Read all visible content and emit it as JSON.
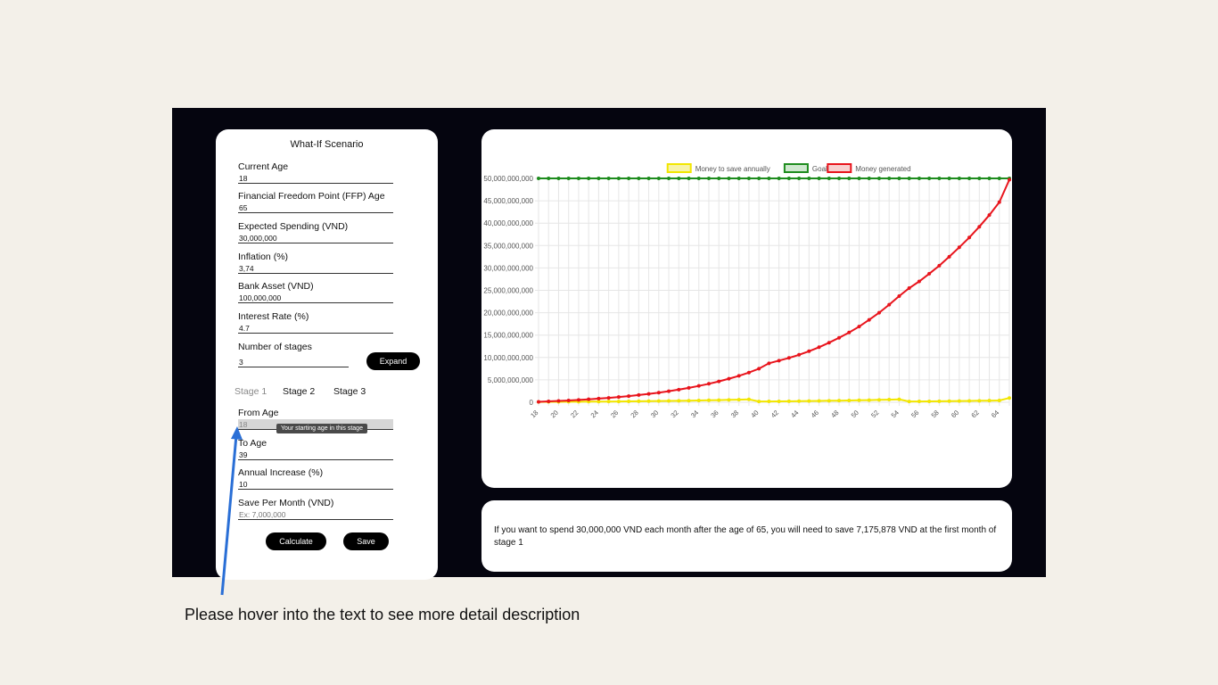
{
  "form": {
    "title": "What-If Scenario",
    "current_age": {
      "label": "Current Age",
      "value": "18"
    },
    "ffp_age": {
      "label": "Financial Freedom Point (FFP) Age",
      "value": "65"
    },
    "spending": {
      "label": "Expected Spending (VND)",
      "value": "30,000,000"
    },
    "inflation": {
      "label": "Inflation (%)",
      "value": "3,74"
    },
    "bank_asset": {
      "label": "Bank Asset (VND)",
      "value": "100,000,000"
    },
    "interest_rate": {
      "label": "Interest Rate (%)",
      "value": "4.7"
    },
    "stages": {
      "label": "Number of stages",
      "value": "3"
    },
    "expand_button": "Expand",
    "tabs": [
      "Stage 1",
      "Stage 2",
      "Stage 3"
    ],
    "from_age": {
      "label": "From Age",
      "value": "18",
      "tooltip": "Your starting age in this stage"
    },
    "to_age": {
      "label": "To Age",
      "value": "39"
    },
    "annual_increase": {
      "label": "Annual Increase (%)",
      "value": "10"
    },
    "save_per_month": {
      "label": "Save Per Month (VND)",
      "placeholder": "Ex: 7,000,000"
    },
    "calculate_button": "Calculate",
    "save_button": "Save"
  },
  "result": {
    "text": "If you want to spend 30,000,000 VND each month after the age of 65, you will need to save 7,175,878 VND at the first month of stage 1"
  },
  "hint": "Please hover into the text to see more detail description",
  "chart_data": {
    "type": "line",
    "x": [
      18,
      19,
      20,
      21,
      22,
      23,
      24,
      25,
      26,
      27,
      28,
      29,
      30,
      31,
      32,
      33,
      34,
      35,
      36,
      37,
      38,
      39,
      40,
      41,
      42,
      43,
      44,
      45,
      46,
      47,
      48,
      49,
      50,
      51,
      52,
      53,
      54,
      55,
      56,
      57,
      58,
      59,
      60,
      61,
      62,
      63,
      64,
      65
    ],
    "x_tick_labels": [
      "18",
      "20",
      "22",
      "24",
      "26",
      "28",
      "30",
      "32",
      "34",
      "36",
      "38",
      "40",
      "42",
      "44",
      "46",
      "48",
      "50",
      "52",
      "54",
      "56",
      "58",
      "60",
      "62",
      "64"
    ],
    "y_tick_labels": [
      "0",
      "5,000,000,000",
      "10,000,000,000",
      "15,000,000,000",
      "20,000,000,000",
      "25,000,000,000",
      "30,000,000,000",
      "35,000,000,000",
      "40,000,000,000",
      "45,000,000,000",
      "50,000,000,000"
    ],
    "ylim": [
      0,
      50000000000
    ],
    "grid": true,
    "legend_position": "top",
    "series": [
      {
        "name": "Money to save annually",
        "color": "#f2e600",
        "fill": "#f7f3a8",
        "values": [
          86000000,
          95000000,
          104000000,
          115000000,
          126000000,
          139000000,
          153000000,
          168000000,
          185000000,
          203000000,
          224000000,
          246000000,
          271000000,
          298000000,
          328000000,
          360000000,
          396000000,
          436000000,
          480000000,
          528000000,
          580000000,
          638000000,
          170000000,
          187000000,
          206000000,
          226000000,
          249000000,
          274000000,
          301000000,
          331000000,
          364000000,
          401000000,
          441000000,
          485000000,
          533000000,
          587000000,
          645000000,
          170000000,
          187000000,
          206000000,
          226000000,
          249000000,
          274000000,
          301000000,
          331000000,
          364000000,
          401000000,
          950000000
        ]
      },
      {
        "name": "Goal",
        "color": "#1e8c1e",
        "fill": "#cfe8cf",
        "values": [
          50000000000,
          50000000000,
          50000000000,
          50000000000,
          50000000000,
          50000000000,
          50000000000,
          50000000000,
          50000000000,
          50000000000,
          50000000000,
          50000000000,
          50000000000,
          50000000000,
          50000000000,
          50000000000,
          50000000000,
          50000000000,
          50000000000,
          50000000000,
          50000000000,
          50000000000,
          50000000000,
          50000000000,
          50000000000,
          50000000000,
          50000000000,
          50000000000,
          50000000000,
          50000000000,
          50000000000,
          50000000000,
          50000000000,
          50000000000,
          50000000000,
          50000000000,
          50000000000,
          50000000000,
          50000000000,
          50000000000,
          50000000000,
          50000000000,
          50000000000,
          50000000000,
          50000000000,
          50000000000,
          50000000000,
          50000000000
        ]
      },
      {
        "name": "Money generated",
        "color": "#e8141c",
        "fill": "#f8d0d0",
        "values": [
          100000000,
          190000000,
          290000000,
          400000000,
          520000000,
          660000000,
          810000000,
          980000000,
          1170000000,
          1380000000,
          1610000000,
          1870000000,
          2150000000,
          2470000000,
          2820000000,
          3210000000,
          3650000000,
          4130000000,
          4660000000,
          5250000000,
          5900000000,
          6630000000,
          7500000000,
          8700000000,
          9300000000,
          9900000000,
          10600000000,
          11400000000,
          12300000000,
          13300000000,
          14400000000,
          15600000000,
          16900000000,
          18400000000,
          20000000000,
          21800000000,
          23700000000,
          25500000000,
          27000000000,
          28700000000,
          30500000000,
          32500000000,
          34600000000,
          36800000000,
          39200000000,
          41800000000,
          44700000000,
          49700000000
        ]
      }
    ]
  }
}
